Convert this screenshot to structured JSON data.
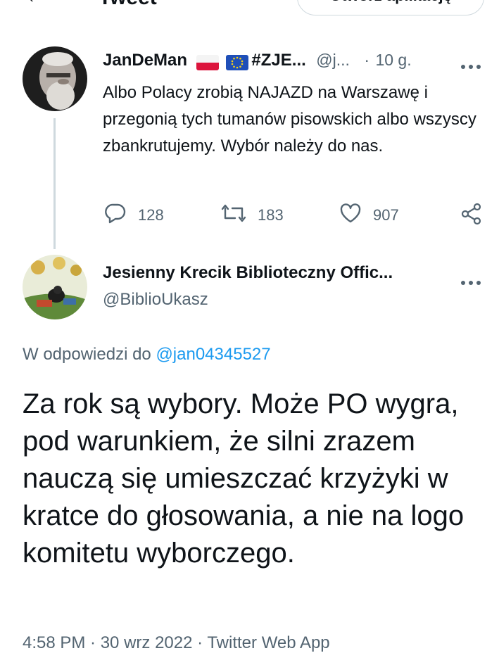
{
  "header": {
    "title": "Tweet",
    "open_app_label": "Otwórz aplikację"
  },
  "parent_tweet": {
    "display_name": "JanDeMan",
    "name_suffix": "#ZJE...",
    "handle": "@j...",
    "separator": "·",
    "time": "10 g.",
    "text": "Albo Polacy zrobią NAJAZD na Warszawę i przegonią tych tumanów pisowskich albo wszyscy zbankrutujemy. Wybór należy do nas.",
    "replies": "128",
    "retweets": "183",
    "likes": "907"
  },
  "reply_tweet": {
    "display_name": "Jesienny Krecik Biblioteczny Offic...",
    "handle": "@BiblioUkasz",
    "reply_prefix": "W odpowiedzi do",
    "reply_handle": "@jan04345527",
    "text": "Za rok są wybory. Może PO wygra, pod warunkiem, że silni zrazem nauczą się umieszczać krzyżyki w kratce do głosowania, a nie na logo komitetu wyborczego.",
    "meta": "4:58 PM · 30 wrz 2022 · Twitter Web App"
  },
  "icons": {
    "back": "arrow-left-icon",
    "more": "more-horizontal-icon",
    "reply": "reply-icon",
    "retweet": "retweet-icon",
    "like": "heart-icon",
    "share": "share-icon"
  },
  "colors": {
    "link": "#1d9bf0",
    "muted": "#536471",
    "text": "#0f1419"
  }
}
